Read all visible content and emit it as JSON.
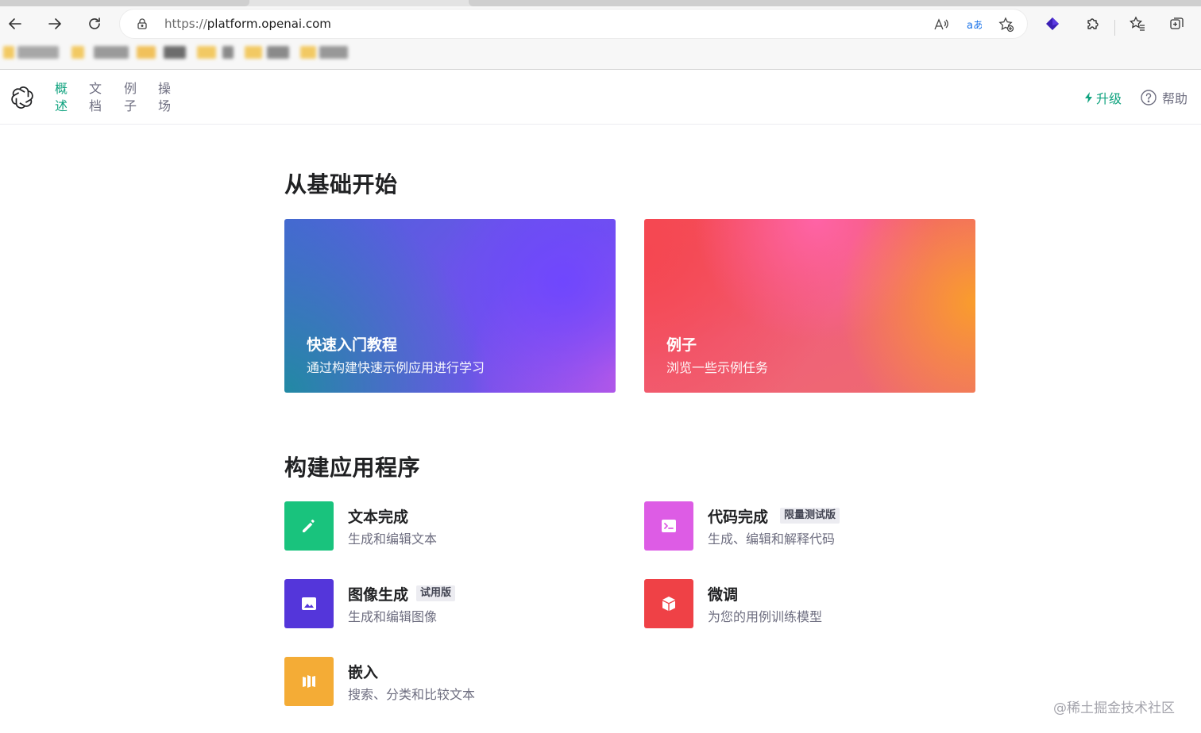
{
  "browser": {
    "url_scheme": "https://",
    "url_host": "platform.openai.com"
  },
  "nav": {
    "items": [
      {
        "label": "概述",
        "active": true
      },
      {
        "label": "文档",
        "active": false
      },
      {
        "label": "例子",
        "active": false
      },
      {
        "label": "操场",
        "active": false
      }
    ],
    "upgrade_label": "升级",
    "help_label": "帮助"
  },
  "main": {
    "section_start_title": "从基础开始",
    "hero_cards": [
      {
        "title": "快速入门教程",
        "description": "通过构建快速示例应用进行学习"
      },
      {
        "title": "例子",
        "description": "浏览一些示例任务"
      }
    ],
    "section_build_title": "构建应用程序",
    "features": [
      {
        "title": "文本完成",
        "badge": "",
        "description": "生成和编辑文本",
        "icon": "pencil-icon",
        "color": "#19c37d"
      },
      {
        "title": "代码完成",
        "badge": "限量测试版",
        "description": "生成、编辑和解释代码",
        "icon": "terminal-icon",
        "color": "#dd5ce5"
      },
      {
        "title": "图像生成",
        "badge": "试用版",
        "description": "生成和编辑图像",
        "icon": "image-icon",
        "color": "#5436da"
      },
      {
        "title": "微调",
        "badge": "",
        "description": "为您的用例训练模型",
        "icon": "cube-icon",
        "color": "#ef4146"
      },
      {
        "title": "嵌入",
        "badge": "",
        "description": "搜索、分类和比较文本",
        "icon": "embeddings-icon",
        "color": "#f4ac36"
      }
    ]
  },
  "watermark": "@稀土掘金技术社区",
  "colors": {
    "accent": "#10a37f",
    "text_primary": "#202123",
    "text_secondary": "#6e6e80"
  }
}
